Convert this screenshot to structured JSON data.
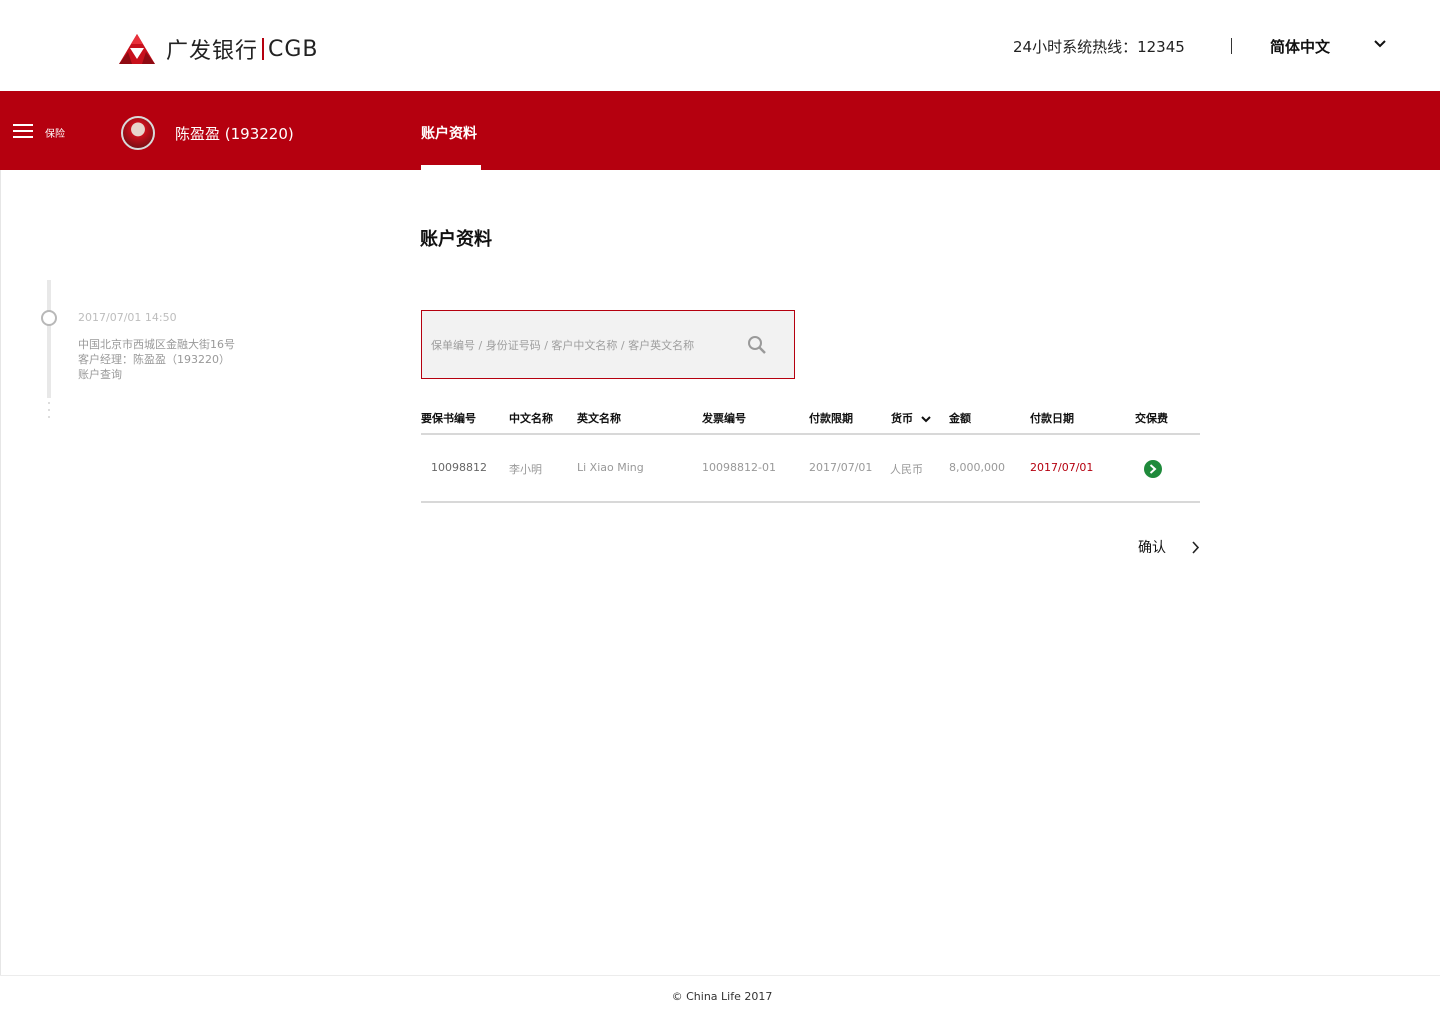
{
  "header": {
    "logo_text": "广发银行",
    "logo_suffix": "CGB",
    "hotline": "24小时系统热线：12345",
    "language": "简体中文",
    "brand_color": "#b5000f"
  },
  "navbar": {
    "menu_label": "保险",
    "user_name": "陈盈盈 (193220)",
    "active_tab": "账户资料"
  },
  "timeline": {
    "datetime": "2017/07/01   14:50",
    "address": "中国北京市西城区金融大街16号",
    "manager": "客户经理：陈盈盈（193220）",
    "action": "账户查询"
  },
  "main": {
    "title": "账户资料",
    "search": {
      "placeholder": "保单编号 / 身份证号码 / 客户中文名称 / 客户英文名称"
    },
    "table": {
      "headers": [
        "要保书编号",
        "中文名称",
        "英文名称",
        "发票编号",
        "付款限期",
        "货币",
        "金额",
        "付款日期",
        "交保费"
      ],
      "rows": [
        {
          "policy_no": "10098812",
          "cn_name": "李小明",
          "en_name": "Li Xiao Ming",
          "invoice_no": "10098812-01",
          "due_date": "2017/07/01",
          "currency": "人民币",
          "amount": "8,000,000",
          "pay_date": "2017/07/01"
        }
      ]
    },
    "confirm_label": "确认"
  },
  "footer": {
    "copyright": "© China Life 2017"
  }
}
